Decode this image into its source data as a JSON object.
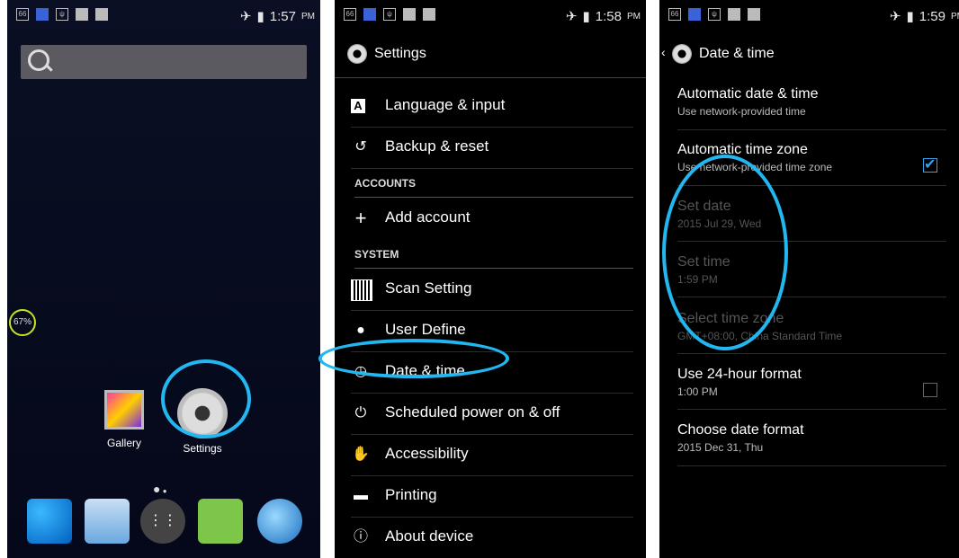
{
  "screen1": {
    "time": "1:57",
    "ampm": "PM",
    "battery": "67%",
    "apps": [
      {
        "label": "Gallery"
      },
      {
        "label": "Settings"
      }
    ],
    "dock_icons": [
      "phone-icon",
      "contacts-icon",
      "app-drawer-icon",
      "messaging-icon",
      "browser-icon"
    ]
  },
  "screen2": {
    "time": "1:58",
    "ampm": "PM",
    "title": "Settings",
    "items": [
      {
        "label": "Language & input"
      },
      {
        "label": "Backup & reset"
      },
      {
        "label": "ACCOUNTS"
      },
      {
        "label": "Add account"
      },
      {
        "label": "SYSTEM"
      },
      {
        "label": "Scan Setting"
      },
      {
        "label": "User Define"
      },
      {
        "label": "Date & time"
      },
      {
        "label": "Scheduled power on & off"
      },
      {
        "label": "Accessibility"
      },
      {
        "label": "Printing"
      },
      {
        "label": "About device"
      }
    ]
  },
  "screen3": {
    "time": "1:59",
    "ampm": "PM",
    "title": "Date & time",
    "rows": [
      {
        "title": "Automatic date & time",
        "sub": "Use network-provided time"
      },
      {
        "title": "Automatic time zone",
        "sub": "Use network-provided time zone",
        "checked": true
      },
      {
        "title": "Set date",
        "sub": "2015 Jul 29, Wed"
      },
      {
        "title": "Set time",
        "sub": "1:59 PM"
      },
      {
        "title": "Select time zone",
        "sub": "GMT+08:00, China Standard Time"
      },
      {
        "title": "Use 24-hour format",
        "sub": "1:00 PM",
        "checked": false
      },
      {
        "title": "Choose date format",
        "sub": "2015 Dec 31, Thu"
      }
    ]
  },
  "colors": {
    "highlight": "#22b7f0",
    "checkbox": "#3aa0e8",
    "battery": "#c8e21e"
  }
}
